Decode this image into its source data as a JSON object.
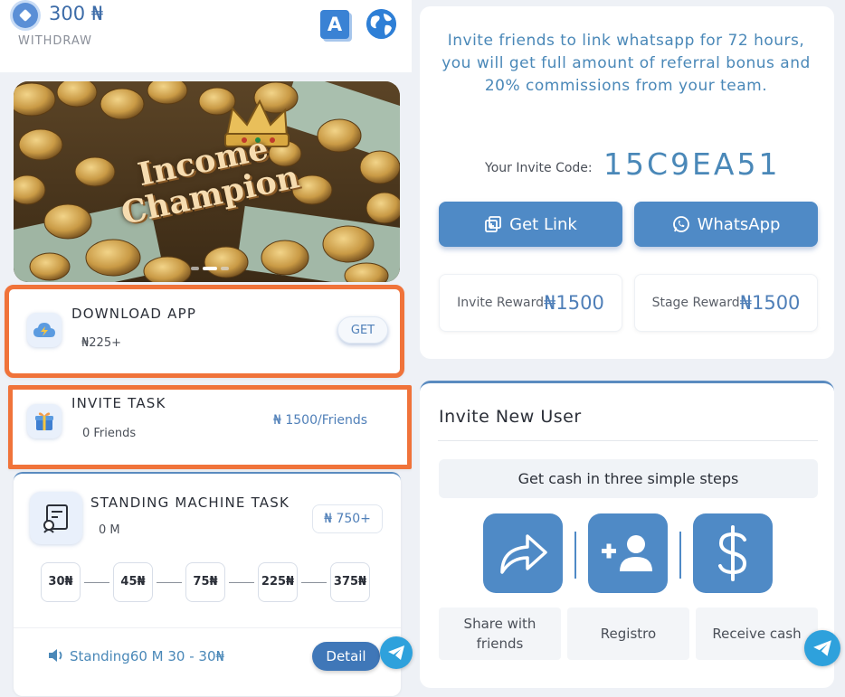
{
  "header": {
    "balance": "300 ₦",
    "withdraw_label": "WITHDRAW",
    "translate_glyph": "A"
  },
  "banner": {
    "title_line1": "Income",
    "title_line2": "Champion"
  },
  "tasks": {
    "download": {
      "title": "DOWNLOAD APP",
      "reward": "₦225+",
      "button": "GET"
    },
    "invite": {
      "title": "INVITE TASK",
      "friends": "0 Friends",
      "rate": "₦ 1500/Friends"
    },
    "standing": {
      "title": "STANDING MACHINE TASK",
      "sub": "0 M",
      "price": "₦ 750+",
      "steps": [
        "30₦",
        "45₦",
        "75₦",
        "225₦",
        "375₦"
      ],
      "footer_text": "Standing60 M 30 - 30₦",
      "detail_button": "Detail"
    }
  },
  "invite_panel": {
    "message": "Invite friends to link whatsapp for 72 hours, you will get full amount of  referral bonus and 20% commissions from your team.",
    "code_label": "Your Invite Code:",
    "code_value": "15C9EA51",
    "get_link_button": "Get Link",
    "whatsapp_button": "WhatsApp",
    "invite_reward_label": "Invite Reward",
    "invite_reward_value": "₦1500",
    "stage_reward_label": "Stage Reward",
    "stage_reward_value": "₦1500"
  },
  "invite_new": {
    "title": "Invite New User",
    "steps_heading": "Get cash in three simple steps",
    "captions": [
      "Share with friends",
      "Registro",
      "Receive cash"
    ]
  },
  "colors": {
    "accent_blue": "#4f8ac6",
    "highlight_orange": "#f0733a",
    "telegram": "#2ea1dc"
  },
  "icons": [
    "diamond-icon",
    "translate-icon",
    "globe-icon",
    "cloud-lightning-icon",
    "gift-icon",
    "machine-icon",
    "speaker-icon",
    "telegram-icon",
    "link-icon",
    "whatsapp-icon",
    "share-arrow-icon",
    "add-user-icon",
    "dollar-icon"
  ]
}
